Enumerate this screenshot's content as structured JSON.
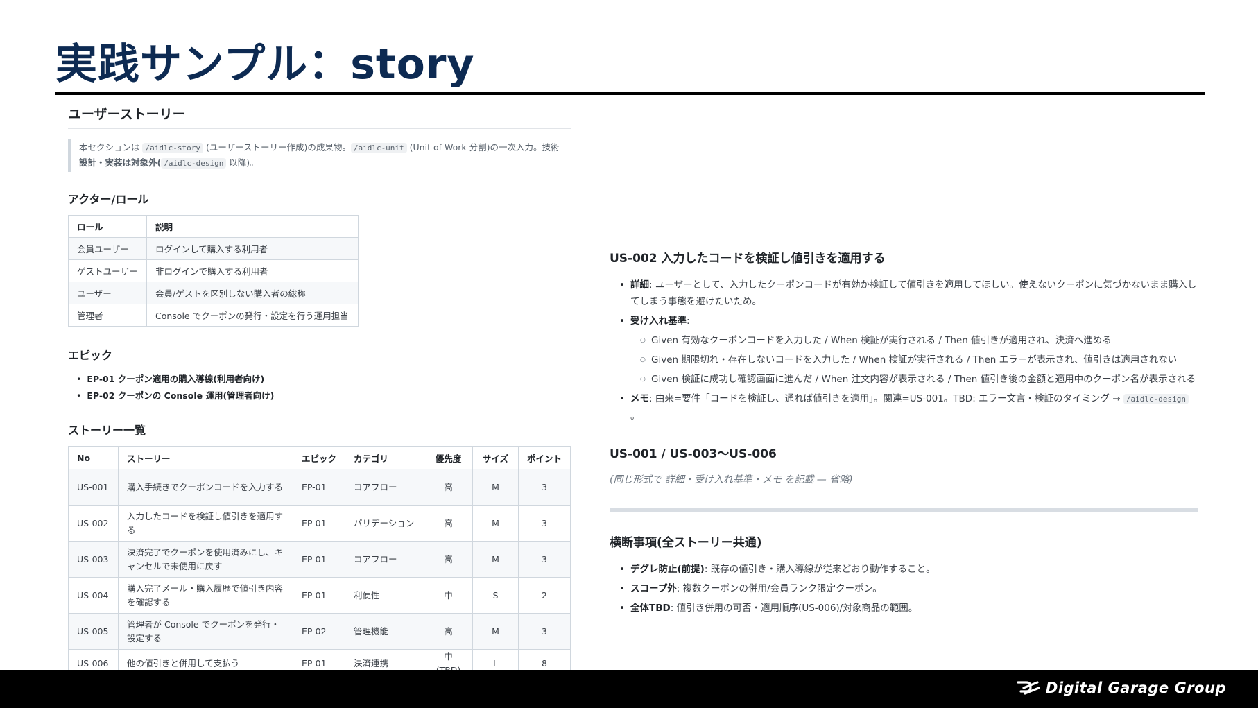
{
  "slide": {
    "title": "実践サンプル：story"
  },
  "left": {
    "heading": "ユーザーストーリー",
    "note": {
      "t1": "本セクションは ",
      "c1": "/aidlc-story",
      "t2": " (ユーザーストーリー作成)の成果物。",
      "c2": "/aidlc-unit",
      "t3": " (Unit of Work 分割)の一次入力。技術",
      "b1": "設計・実装は対象外(",
      "c3": "/aidlc-design",
      "t4": " 以降)。"
    },
    "actors": {
      "heading": "アクター/ロール",
      "headers": [
        "ロール",
        "説明"
      ],
      "rows": [
        [
          "会員ユーザー",
          "ログインして購入する利用者"
        ],
        [
          "ゲストユーザー",
          "非ログインで購入する利用者"
        ],
        [
          "ユーザー",
          "会員/ゲストを区別しない購入者の総称"
        ],
        [
          "管理者",
          "Console でクーポンの発行・設定を行う運用担当"
        ]
      ]
    },
    "epics": {
      "heading": "エピック",
      "items": [
        "EP-01 クーポン適用の購入導線(利用者向け)",
        "EP-02 クーポンの Console 運用(管理者向け)"
      ]
    },
    "stories": {
      "heading": "ストーリー一覧",
      "headers": [
        "No",
        "ストーリー",
        "エピック",
        "カテゴリ",
        "優先度",
        "サイズ",
        "ポイント"
      ],
      "rows": [
        [
          "US-001",
          "購入手続きでクーポンコードを入力する",
          "EP-01",
          "コアフロー",
          "高",
          "M",
          "3"
        ],
        [
          "US-002",
          "入力したコードを検証し値引きを適用する",
          "EP-01",
          "バリデーション",
          "高",
          "M",
          "3"
        ],
        [
          "US-003",
          "決済完了でクーポンを使用済みにし、キャンセルで未使用に戻す",
          "EP-01",
          "コアフロー",
          "高",
          "M",
          "3"
        ],
        [
          "US-004",
          "購入完了メール・購入履歴で値引き内容を確認する",
          "EP-01",
          "利便性",
          "中",
          "S",
          "2"
        ],
        [
          "US-005",
          "管理者が Console でクーポンを発行・設定する",
          "EP-02",
          "管理機能",
          "高",
          "M",
          "3"
        ],
        [
          "US-006",
          "他の値引きと併用して支払う",
          "EP-01",
          "決済連携",
          "中(TBD)",
          "L",
          "8"
        ]
      ]
    }
  },
  "right": {
    "us002": {
      "heading": "US-002 入力したコードを検証し値引きを適用する",
      "detail_label": "詳細",
      "detail_text": ": ユーザーとして、入力したクーポンコードが有効か検証して値引きを適用してほしい。使えないクーポンに気づかないまま購入してしまう事態を避けたいため。",
      "criteria_label": "受け入れ基準",
      "criteria_colon": ":",
      "criteria": [
        "Given 有効なクーポンコードを入力した / When 検証が実行される / Then 値引きが適用され、決済へ進める",
        "Given 期限切れ・存在しないコードを入力した / When 検証が実行される / Then エラーが表示され、値引きは適用されない",
        "Given 検証に成功し確認画面に進んだ / When 注文内容が表示される / Then 値引き後の金額と適用中のクーポン名が表示される"
      ],
      "memo_label": "メモ",
      "memo_text": ": 由来=要件「コードを検証し、通れば値引きを適用」。関連=US-001。TBD: エラー文言・検証のタイミング → ",
      "memo_code": "/aidlc-design",
      "memo_end": " 。"
    },
    "others": {
      "heading": "US-001 / US-003〜US-006",
      "note": "(同じ形式で 詳細・受け入れ基準・メモ を記載 — 省略)"
    },
    "cross": {
      "heading": "横断事項(全ストーリー共通)",
      "items": [
        {
          "label": "デグレ防止(前提)",
          "text": ": 既存の値引き・購入導線が従来どおり動作すること。"
        },
        {
          "label": "スコープ外",
          "text": ": 複数クーポンの併用/会員ランク限定クーポン。"
        },
        {
          "label": "全体TBD",
          "text": ": 値引き併用の可否・適用順序(US-006)/対象商品の範囲。"
        }
      ]
    }
  },
  "footer": {
    "logo_text": "Digital Garage Group"
  }
}
